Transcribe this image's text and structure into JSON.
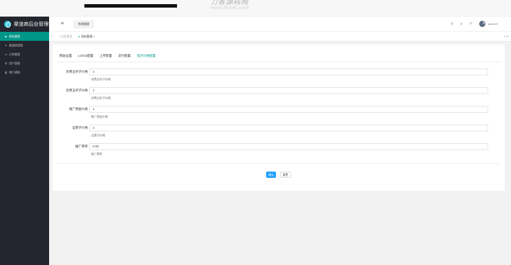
{
  "watermark": {
    "text_cn": "刀客源码网",
    "url": "www.dkewl.com"
  },
  "sidebar": {
    "logo_text": "渠道商后台管理",
    "items": [
      {
        "label": "网站管理",
        "icon": "■"
      },
      {
        "label": "渠道商管理",
        "icon": "✦"
      },
      {
        "label": "订单管理",
        "icon": "▭"
      },
      {
        "label": "用户管理",
        "icon": "⊟"
      },
      {
        "label": "商户通知",
        "icon": "▤"
      }
    ]
  },
  "header": {
    "menu_icon": "≡",
    "tab_label": "系统管理",
    "refresh_icon": "↻",
    "note_icon": "≡",
    "fullscreen_icon": "⤧",
    "admin_label": "admin ▾",
    "more_icon": "⋮"
  },
  "tabsbar": {
    "left_arrow": "‹",
    "home_label": "« 后台首页",
    "current_dot": "●",
    "current_label": "网站管理 ×",
    "right_arrows": "›  »"
  },
  "card": {
    "tabs": [
      "网站设置",
      "LOGO配置",
      "上传配置",
      "支付配置",
      "电子价格配置"
    ],
    "fields": [
      {
        "label": "房费五折子价格",
        "value": "1",
        "hint": "房费五折子价格"
      },
      {
        "label": "房费五折子价格",
        "value": "1",
        "hint": "房费五折子价格"
      },
      {
        "label": "推广佣金价格",
        "value": "1",
        "hint": "推广佣金价格"
      },
      {
        "label": "运营子价格",
        "value": "1",
        "hint": "运营子价格"
      },
      {
        "label": "推广费率",
        "value": "0.03",
        "hint": "推广费率"
      }
    ],
    "confirm_label": "确认",
    "reset_label": "重置"
  }
}
